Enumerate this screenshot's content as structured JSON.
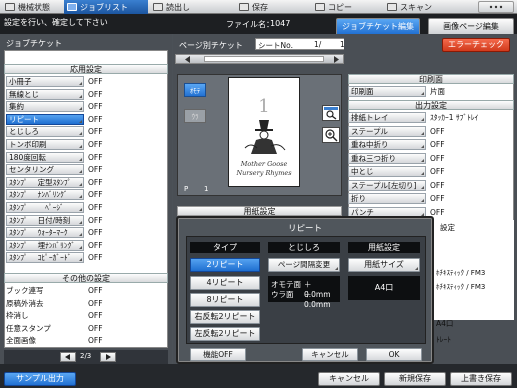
{
  "menu": [
    {
      "label": "機械状態",
      "active": false
    },
    {
      "label": "ジョブリスト",
      "active": true
    },
    {
      "label": "読出し",
      "active": false
    },
    {
      "label": "保存",
      "active": false
    },
    {
      "label": "コピー",
      "active": false
    },
    {
      "label": "スキャン",
      "active": false
    }
  ],
  "header": {
    "instruction": "設定を行い、確定して下さい",
    "file_label": "ファイル名：",
    "file_number": "1047",
    "tab_job_ticket_edit": "ジョブチケット編集",
    "tab_image_page_edit": "画像ページ編集"
  },
  "left": {
    "title": "ジョブチケット",
    "section_applied": "応用設定",
    "items": [
      {
        "label": "小冊子",
        "value": "OFF",
        "selected": false
      },
      {
        "label": "無線とじ",
        "value": "OFF",
        "selected": false
      },
      {
        "label": "集約",
        "value": "OFF",
        "selected": false
      },
      {
        "label": "リピート",
        "value": "OFF",
        "selected": true
      },
      {
        "label": "とじしろ",
        "value": "OFF",
        "selected": false
      },
      {
        "label": "トンボ印刷",
        "value": "OFF",
        "selected": false
      },
      {
        "label": "180度回転",
        "value": "OFF",
        "selected": false
      },
      {
        "label": "センタリング",
        "value": "OFF",
        "selected": false
      },
      {
        "label": "ｽﾀﾝﾌﾟ　 定型ｽﾀﾝﾌﾟ",
        "value": "OFF",
        "selected": false
      },
      {
        "label": "ｽﾀﾝﾌﾟ　 ﾅﾝﾊﾞﾘﾝｸﾞ",
        "value": "OFF",
        "selected": false
      },
      {
        "label": "ｽﾀﾝﾌﾟ　　 ﾍﾟｰｼﾞ",
        "value": "OFF",
        "selected": false
      },
      {
        "label": "ｽﾀﾝﾌﾟ　 日付/時刻",
        "value": "OFF",
        "selected": false
      },
      {
        "label": "ｽﾀﾝﾌﾟ　 ｳｫｰﾀｰﾏｰｸ",
        "value": "OFF",
        "selected": false
      },
      {
        "label": "ｽﾀﾝﾌﾟ　 埋ﾅﾝﾊﾞﾘﾝｸﾞ",
        "value": "OFF",
        "selected": false
      },
      {
        "label": "ｽﾀﾝﾌﾟ　 ｺﾋﾟｰｶﾞｰﾄﾞ",
        "value": "OFF",
        "selected": false
      }
    ],
    "section_other": "その他の設定",
    "other_items": [
      {
        "label": "ブック連写",
        "value": "OFF"
      },
      {
        "label": "原稿外消去",
        "value": "OFF"
      },
      {
        "label": "枠消し",
        "value": "OFF"
      },
      {
        "label": "任意スタンプ",
        "value": "OFF"
      },
      {
        "label": "全面画像",
        "value": "OFF"
      }
    ],
    "pager": "2/3"
  },
  "center": {
    "page_ticket_label": "ページ別チケット",
    "sheet_label": "シートNo.",
    "sheet_value": "1/",
    "sheet_total": "1",
    "side_front": "ｵﾓﾃ",
    "side_back": "ｳﾗ",
    "preview_page_number": "1",
    "preview_title_line1": "Mother Goose",
    "preview_title_line2": "Nursery Rhymes",
    "page_indicator": "P",
    "page_number": "1",
    "paper_settings_label": "用紙設定"
  },
  "right": {
    "error_check": "エラーチェック",
    "print_side_header": "印刷面",
    "print_side_label": "印刷面",
    "print_side_value": "片面",
    "output_header": "出力設定",
    "output_items": [
      {
        "label": "排紙トレイ",
        "value": "ｽﾀｯｶｰ1 ｻﾌﾞﾄﾚｲ"
      },
      {
        "label": "ステープル",
        "value": "OFF"
      },
      {
        "label": "重ね中折り",
        "value": "OFF"
      },
      {
        "label": "重ね三つ折り",
        "value": "OFF"
      },
      {
        "label": "中とじ",
        "value": "OFF"
      },
      {
        "label": "ステープル[左切り]",
        "value": "OFF"
      },
      {
        "label": "折り",
        "value": "OFF"
      },
      {
        "label": "パンチ",
        "value": "OFF"
      }
    ],
    "tail_header": "設定",
    "tail_values": [
      "ﾎﾁｷｽﾃｨｯｸ / FM3",
      "ﾎﾁｷｽﾃｨｯｸ / FM3",
      "A4口",
      "ﾄﾚｰﾄ"
    ]
  },
  "dialog": {
    "title": "リピート",
    "type_header": "タイプ",
    "type_options": [
      "2リピート",
      "4リピート",
      "8リピート",
      "右反転2リピート",
      "左反転2リピート"
    ],
    "binding_header": "とじしろ",
    "page_interval_button": "ページ間隔変更",
    "front_label": "オモテ面",
    "front_value": "＋  0.0mm",
    "back_label": "ウラ面",
    "back_value": "＋  0.0mm",
    "paper_header": "用紙設定",
    "paper_size_button": "用紙サイズ",
    "paper_size_value": "A4口",
    "function_off": "機能OFF",
    "cancel": "キャンセル",
    "ok": "OK"
  },
  "bottom": {
    "sample_output": "サンプル出力",
    "cancel": "キャンセル",
    "new_save": "新規保存",
    "overwrite_save": "上書き保存"
  }
}
